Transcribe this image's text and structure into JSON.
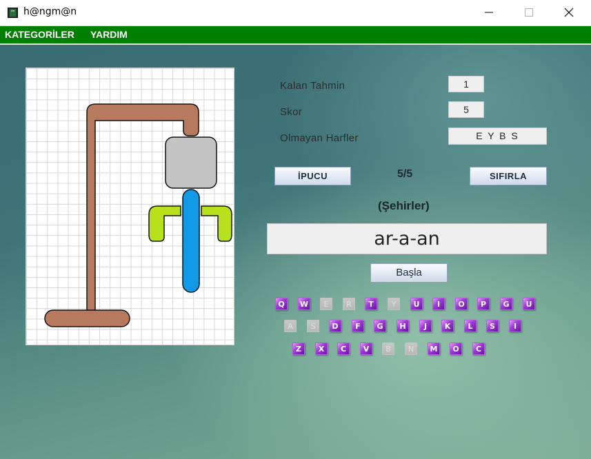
{
  "window": {
    "title": "h@ngm@n",
    "icon": "terminal-app-icon",
    "controls": [
      "minimize-icon",
      "maximize-icon",
      "close-icon"
    ]
  },
  "menu": {
    "categories_label": "KATEGORİLER",
    "help_label": "YARDIM"
  },
  "stats": {
    "remaining_label": "Kalan Tahmin",
    "remaining_value": "1",
    "score_label": "Skor",
    "score_value": "5",
    "missing_label": "Olmayan Harfler",
    "missing_value": "E Y B S"
  },
  "controls": {
    "hint_label": "İPUCU",
    "counter": "5/5",
    "reset_label": "SIFIRLA",
    "category": "(Şehirler)",
    "word": "ar-a-an",
    "start_label": "Başla"
  },
  "keyboard": {
    "rows": [
      [
        {
          "letter": "Q",
          "used": false
        },
        {
          "letter": "W",
          "used": false
        },
        {
          "letter": "E",
          "used": true
        },
        {
          "letter": "R",
          "used": true
        },
        {
          "letter": "T",
          "used": false
        },
        {
          "letter": "Y",
          "used": true
        },
        {
          "letter": "U",
          "used": false
        },
        {
          "letter": "I",
          "used": false
        },
        {
          "letter": "O",
          "used": false
        },
        {
          "letter": "P",
          "used": false
        },
        {
          "letter": "G",
          "used": false
        },
        {
          "letter": "U",
          "used": false
        }
      ],
      [
        {
          "letter": "A",
          "used": true
        },
        {
          "letter": "S",
          "used": true
        },
        {
          "letter": "D",
          "used": false
        },
        {
          "letter": "F",
          "used": false
        },
        {
          "letter": "G",
          "used": false
        },
        {
          "letter": "H",
          "used": false
        },
        {
          "letter": "J",
          "used": false
        },
        {
          "letter": "K",
          "used": false
        },
        {
          "letter": "L",
          "used": false
        },
        {
          "letter": "S",
          "used": false
        },
        {
          "letter": "I",
          "used": false
        }
      ],
      [
        {
          "letter": "Z",
          "used": false
        },
        {
          "letter": "X",
          "used": false
        },
        {
          "letter": "C",
          "used": false
        },
        {
          "letter": "V",
          "used": false
        },
        {
          "letter": "B",
          "used": true
        },
        {
          "letter": "N",
          "used": true
        },
        {
          "letter": "M",
          "used": false
        },
        {
          "letter": "O",
          "used": false
        },
        {
          "letter": "C",
          "used": false
        }
      ]
    ]
  },
  "colors": {
    "menubar": "#008000",
    "gallows": "#b87a5e",
    "head": "#c4c4c4",
    "body": "#1199e6",
    "arms": "#b7e11b",
    "key_active": "#9a34d0",
    "key_used": "#bdbdbd"
  }
}
